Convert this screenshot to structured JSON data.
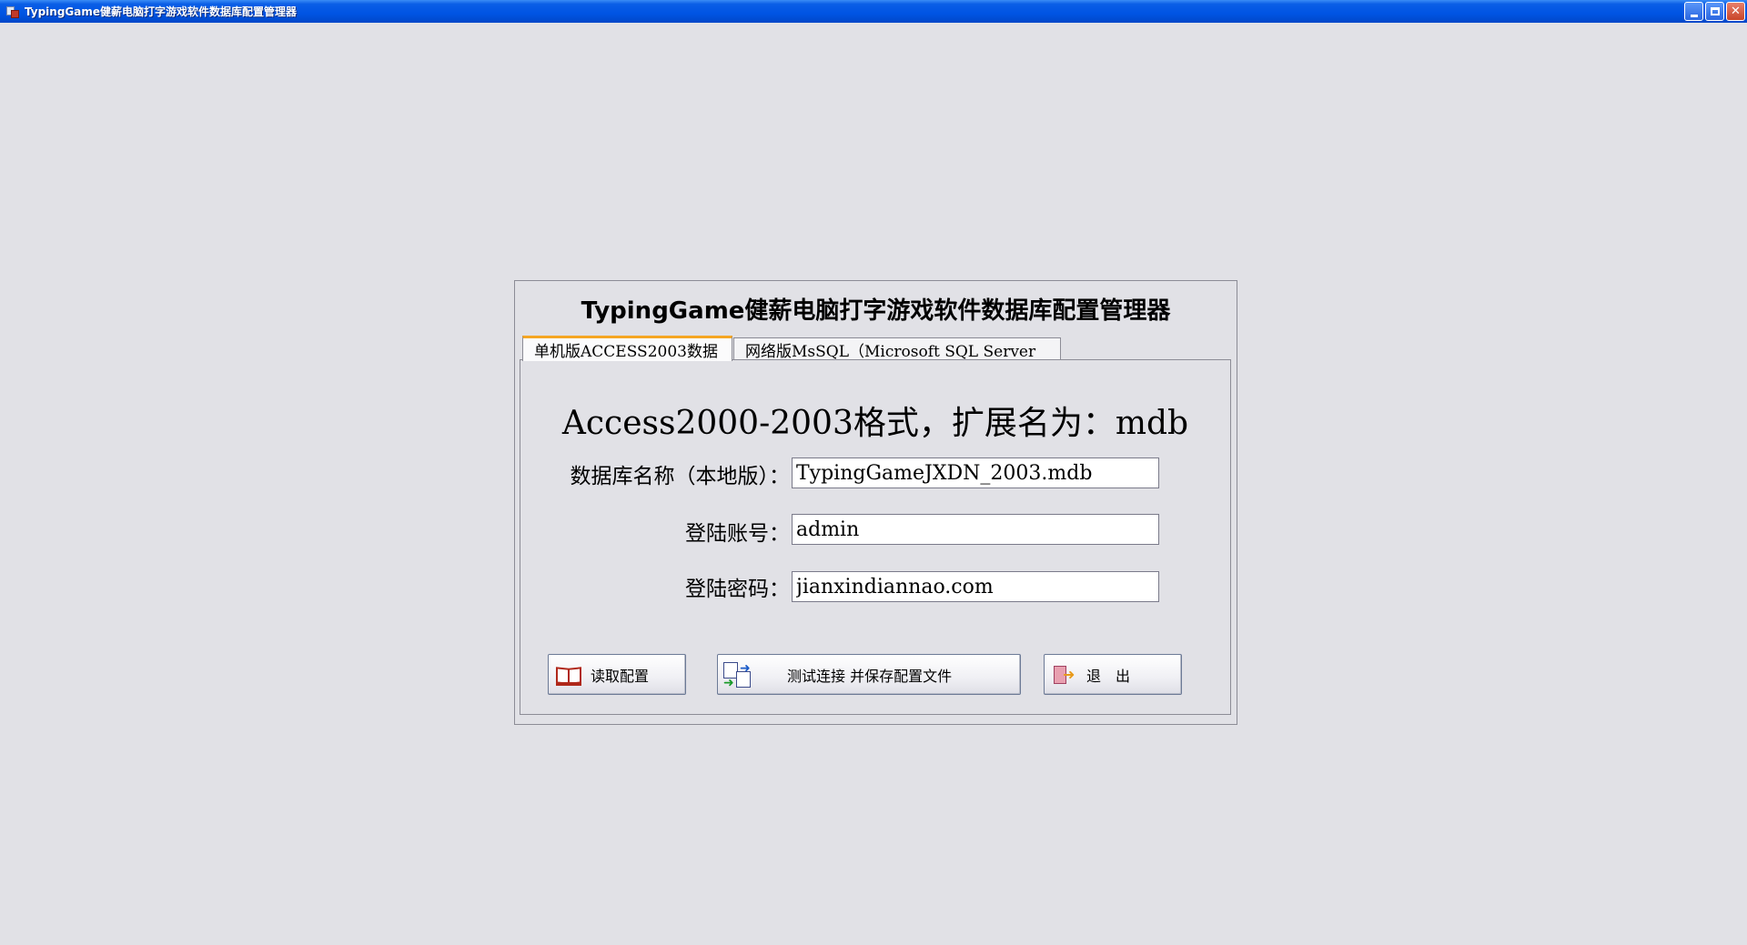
{
  "window": {
    "title": "TypingGame健薪电脑打字游戏软件数据库配置管理器",
    "icon": "app-database-icon",
    "controls": [
      "minimize-icon",
      "maximize-icon",
      "close-icon"
    ]
  },
  "dialog": {
    "heading": "TypingGame健薪电脑打字游戏软件数据库配置管理器",
    "tabs": [
      {
        "label": "单机版ACCESS2003数据",
        "active": true
      },
      {
        "label": "网络版MsSQL（Microsoft  SQL  Server",
        "active": false
      }
    ],
    "format_label": "Access2000-2003格式，扩展名为：mdb",
    "fields": {
      "db_name": {
        "label": "数据库名称（本地版）：",
        "value": "TypingGameJXDN_2003.mdb"
      },
      "account": {
        "label": "登陆账号：",
        "value": "admin"
      },
      "password": {
        "label": "登陆密码：",
        "value": "jianxindiannao.com"
      }
    },
    "buttons": {
      "read_config": {
        "label": "读取配置",
        "icon": "book-icon"
      },
      "test_save": {
        "label": "测试连接 并保存配置文件",
        "icon": "sync-documents-icon"
      },
      "exit": {
        "label": "退　出",
        "icon": "exit-door-icon"
      }
    }
  },
  "colors": {
    "background": "#e1e1e6",
    "titlebar": "#0054e3",
    "active_tab_accent": "#f5a623"
  }
}
